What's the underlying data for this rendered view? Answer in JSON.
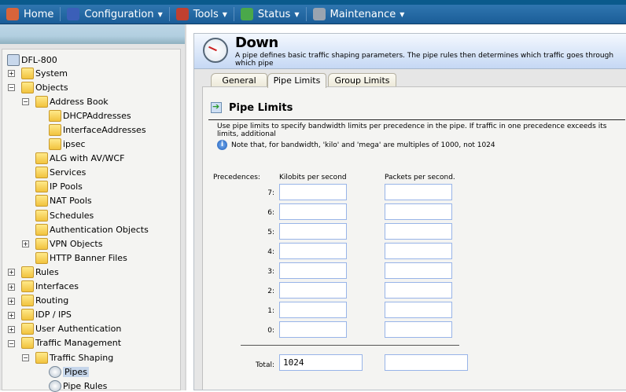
{
  "nav": {
    "items": [
      {
        "label": "Home",
        "icon": "home-icon",
        "color": "#d8643a"
      },
      {
        "label": "Configuration",
        "icon": "configuration-icon",
        "color": "#3b5fb8"
      },
      {
        "label": "Tools",
        "icon": "tools-icon",
        "color": "#c04030"
      },
      {
        "label": "Status",
        "icon": "status-icon",
        "color": "#4aa84a"
      },
      {
        "label": "Maintenance",
        "icon": "maintenance-icon",
        "color": "#9aa4b0"
      }
    ]
  },
  "tree": {
    "root": "DFL-800",
    "items": [
      {
        "label": "System",
        "exp": "+",
        "level": 1
      },
      {
        "label": "Objects",
        "exp": "-",
        "level": 1
      },
      {
        "label": "Address Book",
        "exp": "-",
        "level": 2
      },
      {
        "label": "DHCPAddresses",
        "level": 3
      },
      {
        "label": "InterfaceAddresses",
        "level": 3
      },
      {
        "label": "ipsec",
        "level": 3
      },
      {
        "label": "ALG with AV/WCF",
        "level": 2
      },
      {
        "label": "Services",
        "level": 2
      },
      {
        "label": "IP Pools",
        "level": 2
      },
      {
        "label": "NAT Pools",
        "level": 2
      },
      {
        "label": "Schedules",
        "level": 2
      },
      {
        "label": "Authentication Objects",
        "level": 2
      },
      {
        "label": "VPN Objects",
        "exp": "+",
        "level": 2
      },
      {
        "label": "HTTP Banner Files",
        "level": 2
      },
      {
        "label": "Rules",
        "exp": "+",
        "level": 1
      },
      {
        "label": "Interfaces",
        "exp": "+",
        "level": 1
      },
      {
        "label": "Routing",
        "exp": "+",
        "level": 1
      },
      {
        "label": "IDP / IPS",
        "exp": "+",
        "level": 1
      },
      {
        "label": "User Authentication",
        "exp": "+",
        "level": 1
      },
      {
        "label": "Traffic Management",
        "exp": "-",
        "level": 1
      },
      {
        "label": "Traffic Shaping",
        "exp": "-",
        "level": 2
      },
      {
        "label": "Pipes",
        "level": 3,
        "selected": true
      },
      {
        "label": "Pipe Rules",
        "level": 3
      }
    ]
  },
  "header": {
    "title": "Down",
    "description": "A pipe defines basic traffic shaping parameters. The pipe rules then determines which traffic goes through which pipe"
  },
  "tabs": [
    {
      "label": "General"
    },
    {
      "label": "Pipe Limits",
      "active": true
    },
    {
      "label": "Group Limits"
    }
  ],
  "section": {
    "title": "Pipe Limits",
    "description": "Use pipe limits to specify bandwidth limits per precedence in the pipe. If traffic in one precedence exceeds its limits, additional",
    "note": "Note that, for bandwidth, 'kilo' and 'mega' are multiples of 1000, not 1024",
    "precedences_label": "Precedences:",
    "col_kbps": "Kilobits per second",
    "col_pps": "Packets per second.",
    "rows": [
      {
        "label": "7:",
        "kbps": "",
        "pps": ""
      },
      {
        "label": "6:",
        "kbps": "",
        "pps": ""
      },
      {
        "label": "5:",
        "kbps": "",
        "pps": ""
      },
      {
        "label": "4:",
        "kbps": "",
        "pps": ""
      },
      {
        "label": "3:",
        "kbps": "",
        "pps": ""
      },
      {
        "label": "2:",
        "kbps": "",
        "pps": ""
      },
      {
        "label": "1:",
        "kbps": "",
        "pps": ""
      },
      {
        "label": "0:",
        "kbps": "",
        "pps": ""
      }
    ],
    "total_label": "Total:",
    "total_kbps": "1024",
    "total_pps": ""
  }
}
